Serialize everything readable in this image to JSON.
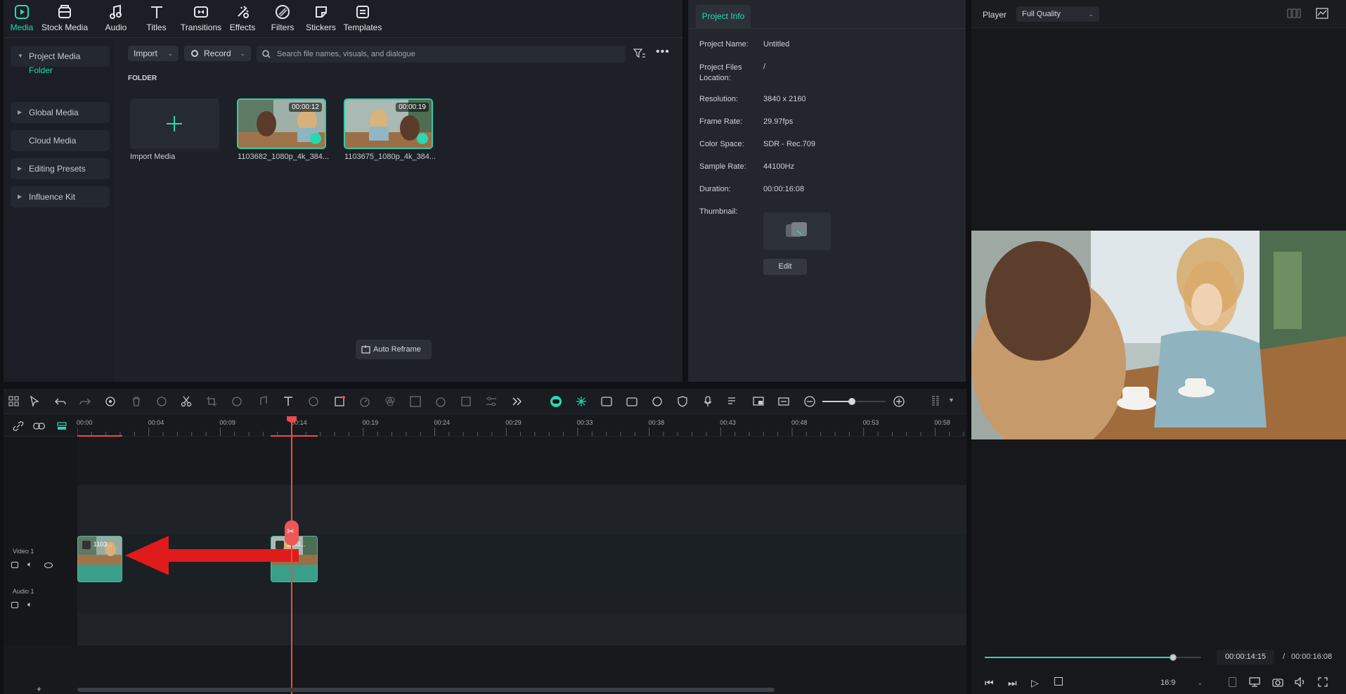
{
  "top_tabs": [
    {
      "label": "Media",
      "icon": "media-icon"
    },
    {
      "label": "Stock Media",
      "icon": "stock-media-icon"
    },
    {
      "label": "Audio",
      "icon": "audio-icon"
    },
    {
      "label": "Titles",
      "icon": "titles-icon"
    },
    {
      "label": "Transitions",
      "icon": "transitions-icon"
    },
    {
      "label": "Effects",
      "icon": "effects-icon"
    },
    {
      "label": "Filters",
      "icon": "filters-icon"
    },
    {
      "label": "Stickers",
      "icon": "stickers-icon"
    },
    {
      "label": "Templates",
      "icon": "templates-icon"
    }
  ],
  "sidebar": {
    "project_media": "Project Media",
    "folder": "Folder",
    "global_media": "Global Media",
    "cloud_media": "Cloud Media",
    "editing_presets": "Editing Presets",
    "influence_kit": "Influence Kit"
  },
  "media_toolbar": {
    "import_label": "Import",
    "record_label": "Record",
    "search_placeholder": "Search file names, visuals, and dialogue"
  },
  "folder_heading": "FOLDER",
  "media_items": [
    {
      "label": "Import Media"
    },
    {
      "label": "1103682_1080p_4k_384...",
      "duration": "00:00:12"
    },
    {
      "label": "1103675_1080p_4k_384...",
      "duration": "00:00:19"
    }
  ],
  "auto_reframe": "Auto Reframe",
  "project_info": {
    "tab": "Project Info",
    "rows": [
      {
        "label": "Project Name:",
        "value": "Untitled"
      },
      {
        "label": "Project Files Location:",
        "value": "/"
      },
      {
        "label": "Resolution:",
        "value": "3840 x 2160"
      },
      {
        "label": "Frame Rate:",
        "value": "29.97fps"
      },
      {
        "label": "Color Space:",
        "value": "SDR - Rec.709"
      },
      {
        "label": "Sample Rate:",
        "value": "44100Hz"
      },
      {
        "label": "Duration:",
        "value": "00:00:16:08"
      },
      {
        "label": "Thumbnail:",
        "value": ""
      }
    ],
    "edit_label": "Edit"
  },
  "player": {
    "label": "Player",
    "quality": "Full Quality",
    "current_time": "00:00:14:15",
    "separator": "/",
    "total_time": "00:00:16:08",
    "aspect": "16:9",
    "progress": 0.87
  },
  "ruler_labels": [
    "00:00",
    "00:04",
    "00:09",
    "00:14",
    "00:19",
    "00:24",
    "00:29",
    "00:33",
    "00:38",
    "00:43",
    "00:48",
    "00:53",
    "00:58"
  ],
  "tracks": {
    "video1": "Video 1",
    "audio1": "Audio 1",
    "clip_a": "1103...",
    "clip_b": "1103..."
  },
  "colors": {
    "accent": "#27d9b3",
    "playhead": "#ef4a4a",
    "arrow": "#e01b1b",
    "clip": "#3a9f89"
  }
}
